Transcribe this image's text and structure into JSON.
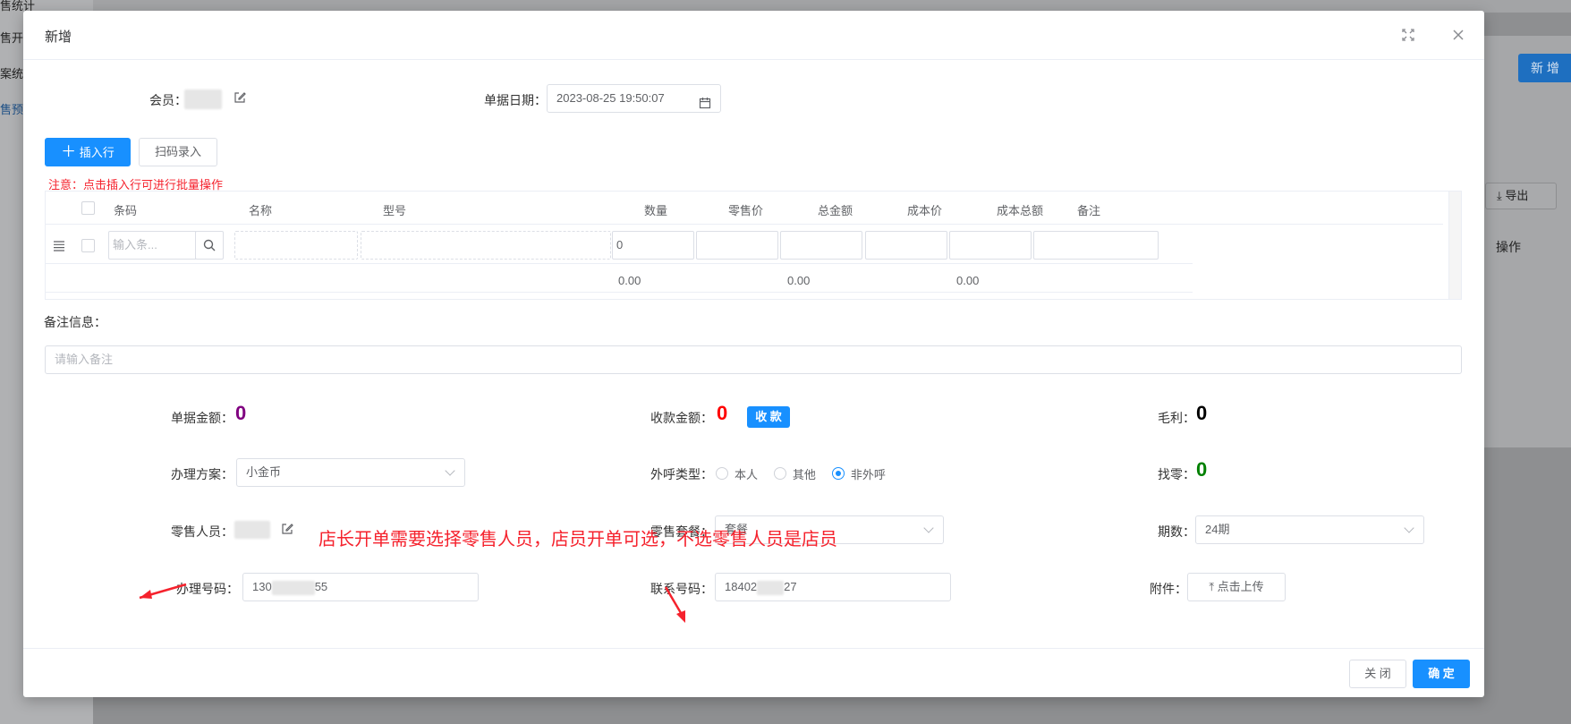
{
  "background": {
    "sidebar_items": [
      "售统计",
      "售开单",
      "案统计",
      "售预算"
    ],
    "new_button": "新 增",
    "export_button": "导出",
    "operation_col": "操作"
  },
  "modal": {
    "title": "新增",
    "member_label": "会员：",
    "date_label": "单据日期：",
    "date_value": "2023-08-25 19:50:07",
    "insert_row_button": "插入行",
    "scan_entry_button": "扫码录入",
    "notice": "注意：点击插入行可进行批量操作",
    "table": {
      "headers": [
        "条码",
        "名称",
        "型号",
        "数量",
        "零售价",
        "总金额",
        "成本价",
        "成本总额",
        "备注"
      ],
      "barcode_placeholder": "输入条...",
      "qty_value": "0",
      "sums": [
        "0.00",
        "0.00",
        "0.00"
      ]
    },
    "remark_label": "备注信息：",
    "remark_placeholder": "请输入备注",
    "doc_amount_label": "单据金额：",
    "doc_amount_value": "0",
    "receive_amount_label": "收款金额：",
    "receive_amount_value": "0",
    "collect_button": "收 款",
    "profit_label": "毛利：",
    "profit_value": "0",
    "plan_label": "办理方案：",
    "plan_value": "小金币",
    "call_type_label": "外呼类型：",
    "call_options": [
      "本人",
      "其他",
      "非外呼"
    ],
    "call_selected": "非外呼",
    "change_label": "找零：",
    "change_value": "0",
    "seller_label": "零售人员：",
    "package_label": "零售套餐：",
    "package_value": "套餐",
    "period_label": "期数：",
    "period_value": "24期",
    "handle_phone_label": "办理号码：",
    "handle_phone_prefix": "130",
    "handle_phone_suffix": "55",
    "contact_phone_label": "联系号码：",
    "contact_phone_prefix": "18402",
    "contact_phone_suffix": "27",
    "attachment_label": "附件：",
    "upload_button": "点击上传",
    "close_button": "关 闭",
    "confirm_button": "确 定"
  },
  "annotation": {
    "text": "店长开单需要选择零售人员，店员开单可选，不选零售人员是店员"
  },
  "colors": {
    "primary": "#1890ff",
    "doc_amount": "#800080",
    "receive_amount": "#ff0000",
    "change": "#008000",
    "annotation": "#f5222d"
  }
}
